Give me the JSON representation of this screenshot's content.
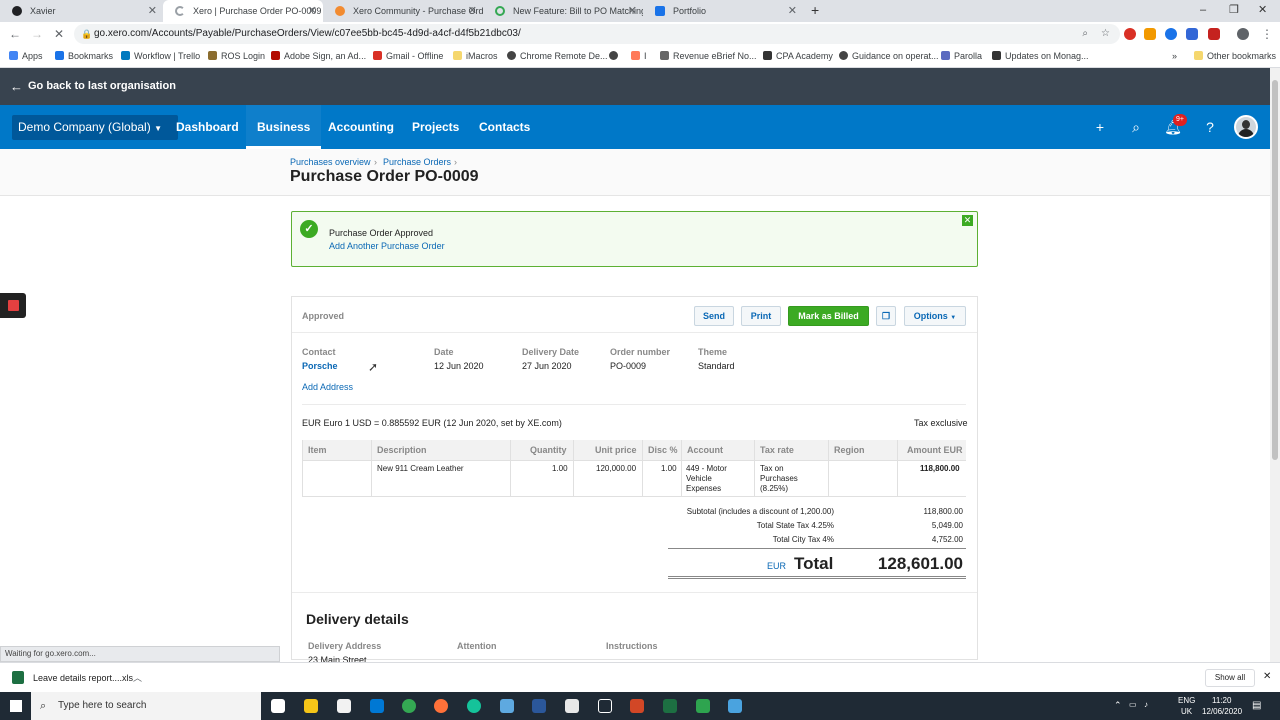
{
  "browser": {
    "tabs": [
      {
        "label": "Xavier",
        "color": "#202124"
      },
      {
        "label": "Xero | Purchase Order PO-0009 |",
        "color": "#9aa0a6"
      },
      {
        "label": "Xero Community - Purchase Ord",
        "color": "#f28b30"
      },
      {
        "label": "New Feature: Bill to PO Matching",
        "color": "#34a853"
      },
      {
        "label": "Portfolio",
        "color": "#1a73e8"
      }
    ],
    "url": "go.xero.com/Accounts/Payable/PurchaseOrders/View/c07ee5bb-bc45-4d9d-a4cf-d4f5b21dbc03/",
    "bookmarks": [
      {
        "label": "Apps",
        "color": "#4285f4"
      },
      {
        "label": "Bookmarks",
        "color": "#1a73e8"
      },
      {
        "label": "Workflow | Trello",
        "color": "#0079bf"
      },
      {
        "label": "ROS Login",
        "color": "#8b6d2f"
      },
      {
        "label": "Adobe Sign, an Ad...",
        "color": "#b30b00"
      },
      {
        "label": "Gmail - Offline",
        "color": "#d93025"
      },
      {
        "label": "iMacros",
        "color": "#f5d76e"
      },
      {
        "label": "Chrome Remote De...",
        "color": "#444444"
      },
      {
        "label": "I",
        "color": "#ff7a59"
      },
      {
        "label": "Revenue eBrief No...",
        "color": "#666666"
      },
      {
        "label": "CPA Academy",
        "color": "#333333"
      },
      {
        "label": "Guidance on operat...",
        "color": "#444444"
      },
      {
        "label": "Parolla",
        "color": "#5c6bc0"
      },
      {
        "label": "Updates on Monag...",
        "color": "#333333"
      }
    ],
    "other_bookmarks": "Other bookmarks",
    "status": "Waiting for go.xero.com..."
  },
  "xero": {
    "back_label": "Go back to last organisation",
    "org": "Demo Company (Global)",
    "nav": [
      "Dashboard",
      "Business",
      "Accounting",
      "Projects",
      "Contacts"
    ],
    "notif_badge": "9+"
  },
  "page": {
    "breadcrumb": [
      "Purchases overview",
      "Purchase Orders"
    ],
    "title": "Purchase Order PO-0009"
  },
  "success": {
    "message": "Purchase Order Approved",
    "link": "Add Another Purchase Order"
  },
  "order": {
    "status": "Approved",
    "buttons": {
      "send": "Send",
      "print": "Print",
      "mark_billed": "Mark as Billed",
      "options": "Options"
    },
    "fields": {
      "contact_label": "Contact",
      "contact": "Porsche",
      "date_label": "Date",
      "date": "12 Jun 2020",
      "delivery_label": "Delivery Date",
      "delivery": "27 Jun 2020",
      "number_label": "Order number",
      "number": "PO-0009",
      "theme_label": "Theme",
      "theme": "Standard"
    },
    "add_address": "Add Address",
    "currency_line": "EUR Euro 1 USD = 0.885592 EUR (12 Jun 2020, set by XE.com)",
    "tax_mode": "Tax exclusive",
    "columns": [
      "Item",
      "Description",
      "Quantity",
      "Unit price",
      "Disc %",
      "Account",
      "Tax rate",
      "Region",
      "Amount EUR"
    ],
    "line": {
      "item": "",
      "description": "New 911 Cream Leather",
      "quantity": "1.00",
      "unit_price": "120,000.00",
      "disc": "1.00",
      "account": [
        "449 - Motor",
        "Vehicle",
        "Expenses"
      ],
      "tax_rate": [
        "Tax on",
        "Purchases",
        "(8.25%)"
      ],
      "region": "",
      "amount": "118,800.00"
    },
    "totals": {
      "subtotal_label": "Subtotal (includes a discount of 1,200.00)",
      "subtotal": "118,800.00",
      "state_label": "Total State Tax 4.25%",
      "state": "5,049.00",
      "city_label": "Total City Tax 4%",
      "city": "4,752.00",
      "currency": "EUR",
      "total_label": "Total",
      "total": "128,601.00"
    }
  },
  "delivery": {
    "heading": "Delivery details",
    "address_label": "Delivery Address",
    "attention_label": "Attention",
    "instructions_label": "Instructions",
    "address_line": "23 Main Street"
  },
  "downloads": {
    "file": "Leave details report....xls",
    "show_all": "Show all"
  },
  "taskbar": {
    "search_placeholder": "Type here to search",
    "lang": "ENG",
    "region": "UK",
    "time": "11:20",
    "date": "12/06/2020"
  }
}
